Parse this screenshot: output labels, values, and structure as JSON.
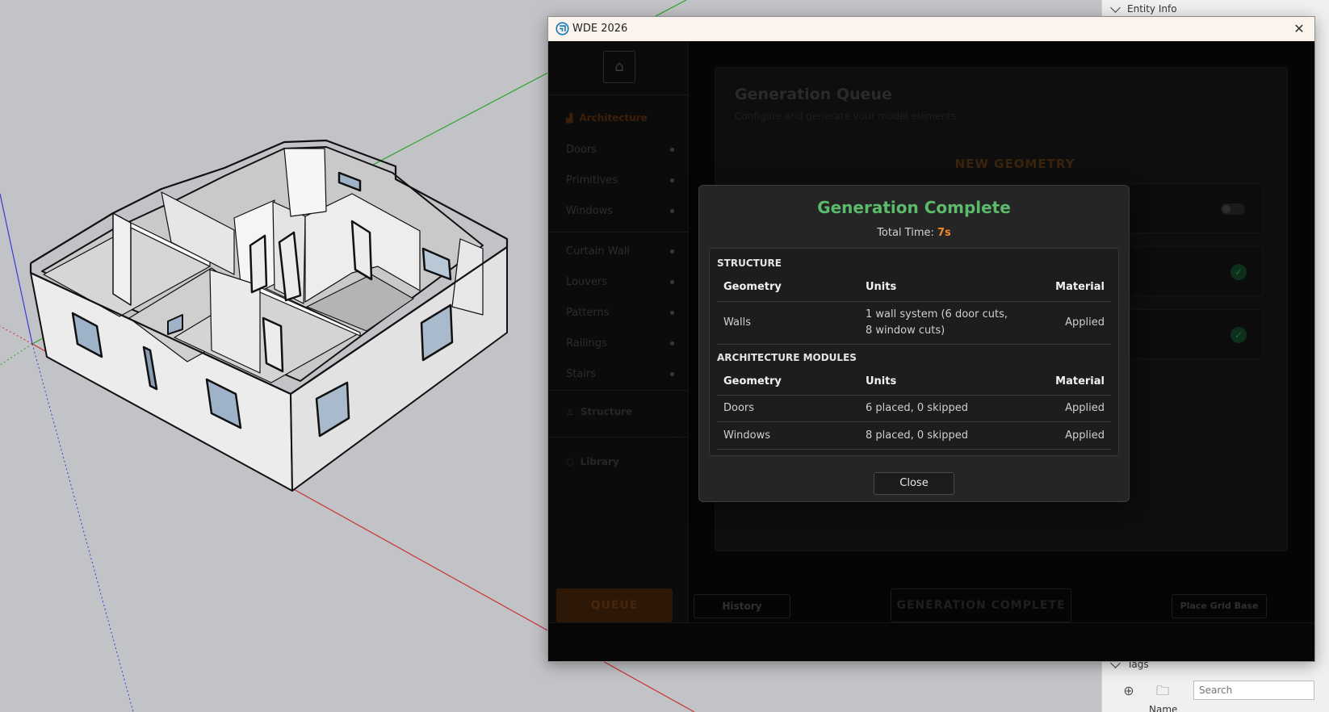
{
  "tray": {
    "entity_info": "Entity Info",
    "tags": "Tags",
    "search_placeholder": "Search",
    "name_col": "Name"
  },
  "window": {
    "title": "WDE 2026"
  },
  "sidebar": {
    "architecture": "Architecture",
    "items": [
      {
        "label": "Doors"
      },
      {
        "label": "Primitives"
      },
      {
        "label": "Windows"
      },
      {
        "label": "Curtain Wall"
      },
      {
        "label": "Louvers"
      },
      {
        "label": "Patterns"
      },
      {
        "label": "Railings"
      },
      {
        "label": "Stairs"
      }
    ],
    "structure": "Structure",
    "library": "Library"
  },
  "main": {
    "title": "Generation Queue",
    "subtitle": "Configure and generate your model elements",
    "new_geometry": "NEW GEOMETRY"
  },
  "footer": {
    "queue": "QUEUE",
    "history": "History",
    "generation": "GENERATION COMPLETE",
    "place_grid": "Place Grid Base"
  },
  "modal": {
    "title": "Generation Complete",
    "time_label": "Total Time:",
    "time_value": "7s",
    "close": "Close",
    "structure": {
      "title": "STRUCTURE",
      "headers": [
        "Geometry",
        "Units",
        "Material"
      ],
      "rows": [
        {
          "geometry": "Walls",
          "units_line1": "1 wall system (6 door cuts,",
          "units_line2": "8 window cuts)",
          "material": "Applied"
        }
      ]
    },
    "architecture": {
      "title": "ARCHITECTURE MODULES",
      "headers": [
        "Geometry",
        "Units",
        "Material"
      ],
      "rows": [
        {
          "geometry": "Doors",
          "units": "6 placed, 0 skipped",
          "material": "Applied"
        },
        {
          "geometry": "Windows",
          "units": "8 placed, 0 skipped",
          "material": "Applied"
        }
      ]
    }
  },
  "colors": {
    "accent_orange": "#f08a2a",
    "success_green": "#5bbb6b",
    "axis_red": "#c83232",
    "axis_green": "#2aa52a",
    "axis_blue": "#3a3ad6"
  }
}
